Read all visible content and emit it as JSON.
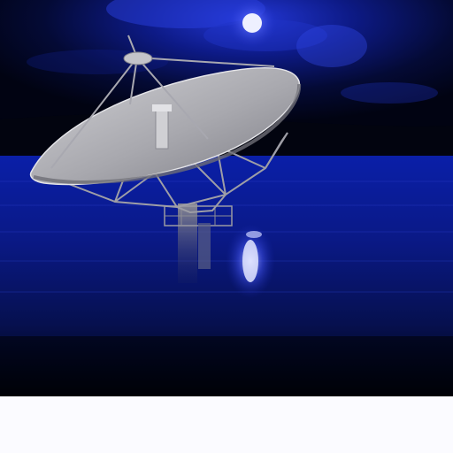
{
  "image": {
    "subject": "radio-telescope-dish",
    "setting": "night-lake-with-moon",
    "palette": {
      "sky_dark": "#02061a",
      "sky_glow": "#1c2fbf",
      "moon": "#eef0ff",
      "water": "#0a1d9a",
      "dish": "#b9b9bd",
      "strip": "#fbfbff"
    }
  }
}
